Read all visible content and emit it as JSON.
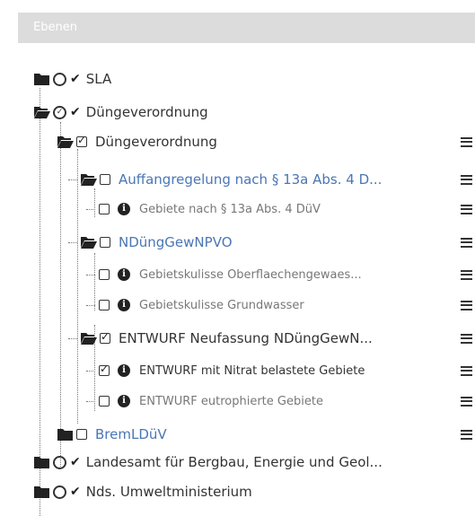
{
  "header": {
    "title": "Ebenen"
  },
  "tree": {
    "sla": {
      "label": "SLA"
    },
    "duengeverordnung_root": {
      "label": "Düngeverordnung"
    },
    "duengeverordnung_group": {
      "label": "Düngeverordnung"
    },
    "auffangregelung": {
      "label": "Auffangregelung nach § 13a Abs. 4 D..."
    },
    "gebiete_13a": {
      "label": "Gebiete nach § 13a Abs. 4 DüV"
    },
    "nduenggewnpvo": {
      "label": "NDüngGewNPVO"
    },
    "gebietskulisse_oberflaeche": {
      "label": "Gebietskulisse Oberflaechengewaes..."
    },
    "gebietskulisse_grundwasser": {
      "label": "Gebietskulisse Grundwasser"
    },
    "entwurf_neufassung": {
      "label": "ENTWURF Neufassung NDüngGewN..."
    },
    "entwurf_nitrat": {
      "label": "ENTWURF mit Nitrat belastete Gebiete"
    },
    "entwurf_eutroph": {
      "label": "ENTWURF eutrophierte Gebiete"
    },
    "bremlduev": {
      "label": "BremLDüV"
    },
    "lbeg": {
      "label": "Landesamt für Bergbau, Energie und Geol..."
    },
    "umweltministerium": {
      "label": "Nds. Umweltministerium"
    }
  }
}
